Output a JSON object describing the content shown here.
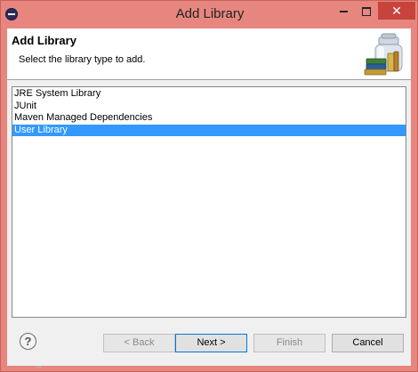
{
  "window": {
    "title": "Add Library",
    "app_icon": "eclipse-icon",
    "close_glyph": "✕"
  },
  "header": {
    "title": "Add Library",
    "description": "Select the library type to add.",
    "banner_icon": "library-books-jar-icon"
  },
  "library_types": [
    {
      "label": "JRE System Library",
      "selected": false
    },
    {
      "label": "JUnit",
      "selected": false
    },
    {
      "label": "Maven Managed Dependencies",
      "selected": false
    },
    {
      "label": "User Library",
      "selected": true
    }
  ],
  "buttons": {
    "help": "?",
    "back": "< Back",
    "next": "Next >",
    "finish": "Finish",
    "cancel": "Cancel"
  },
  "colors": {
    "title_bar": "#e6867f",
    "close_button": "#c7443c",
    "selection": "#3399ff",
    "dialog_background": "#f0f0f0"
  }
}
